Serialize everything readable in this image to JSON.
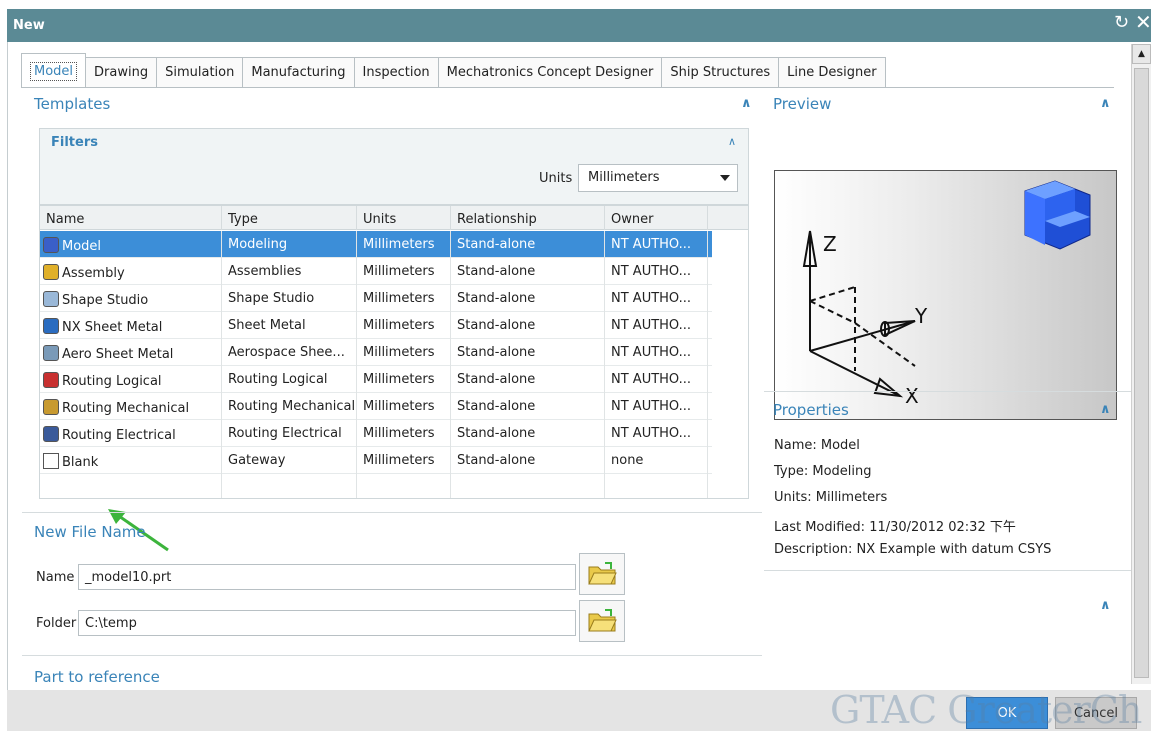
{
  "window": {
    "title": "New",
    "reset_glyph": "↻",
    "close_glyph": "✕"
  },
  "tabs": [
    {
      "label": "Model",
      "active": true
    },
    {
      "label": "Drawing"
    },
    {
      "label": "Simulation"
    },
    {
      "label": "Manufacturing"
    },
    {
      "label": "Inspection"
    },
    {
      "label": "Mechatronics Concept Designer"
    },
    {
      "label": "Ship Structures"
    },
    {
      "label": "Line Designer"
    }
  ],
  "templates": {
    "title": "Templates",
    "filters": {
      "title": "Filters",
      "units_label": "Units",
      "units_value": "Millimeters"
    },
    "columns": [
      "Name",
      "Type",
      "Units",
      "Relationship",
      "Owner"
    ],
    "rows": [
      {
        "name": "Model",
        "type": "Modeling",
        "units": "Millimeters",
        "relationship": "Stand-alone",
        "owner": "NT AUTHO...",
        "icon": "model-icon",
        "selected": true
      },
      {
        "name": "Assembly",
        "type": "Assemblies",
        "units": "Millimeters",
        "relationship": "Stand-alone",
        "owner": "NT AUTHO...",
        "icon": "assembly-icon"
      },
      {
        "name": "Shape Studio",
        "type": "Shape Studio",
        "units": "Millimeters",
        "relationship": "Stand-alone",
        "owner": "NT AUTHO...",
        "icon": "shape-studio-icon"
      },
      {
        "name": "NX Sheet Metal",
        "type": "Sheet Metal",
        "units": "Millimeters",
        "relationship": "Stand-alone",
        "owner": "NT AUTHO...",
        "icon": "sheet-metal-icon"
      },
      {
        "name": "Aero Sheet Metal",
        "type": "Aerospace Shee...",
        "units": "Millimeters",
        "relationship": "Stand-alone",
        "owner": "NT AUTHO...",
        "icon": "aero-sheet-metal-icon"
      },
      {
        "name": "Routing Logical",
        "type": "Routing Logical",
        "units": "Millimeters",
        "relationship": "Stand-alone",
        "owner": "NT AUTHO...",
        "icon": "routing-logical-icon"
      },
      {
        "name": "Routing Mechanical",
        "type": "Routing Mechanical",
        "units": "Millimeters",
        "relationship": "Stand-alone",
        "owner": "NT AUTHO...",
        "icon": "routing-mechanical-icon"
      },
      {
        "name": "Routing Electrical",
        "type": "Routing Electrical",
        "units": "Millimeters",
        "relationship": "Stand-alone",
        "owner": "NT AUTHO...",
        "icon": "routing-electrical-icon"
      },
      {
        "name": "Blank",
        "type": "Gateway",
        "units": "Millimeters",
        "relationship": "Stand-alone",
        "owner": "none",
        "icon": "blank-page-icon"
      }
    ]
  },
  "new_file": {
    "title": "New File Name",
    "name_label": "Name",
    "name_value": "_model10.prt",
    "folder_label": "Folder",
    "folder_value": "C:\\temp"
  },
  "part_to_reference": {
    "title": "Part to reference"
  },
  "preview": {
    "title": "Preview",
    "axis_z": "Z",
    "axis_y": "Y",
    "axis_x": "X"
  },
  "properties": {
    "title": "Properties",
    "name": "Name: Model",
    "type": "Type: Modeling",
    "units": "Units: Millimeters",
    "last_modified": "Last Modified: 11/30/2012 02:32 下午",
    "description": "Description: NX Example with datum CSYS"
  },
  "buttons": {
    "ok": "OK",
    "cancel": "Cancel"
  },
  "watermark": "GTAC GreaterCh",
  "colors": {
    "title_bar": "#5b8a95",
    "accent": "#3a84b8",
    "selection": "#3c8ed8",
    "annotation_arrow": "#3cb43c"
  }
}
